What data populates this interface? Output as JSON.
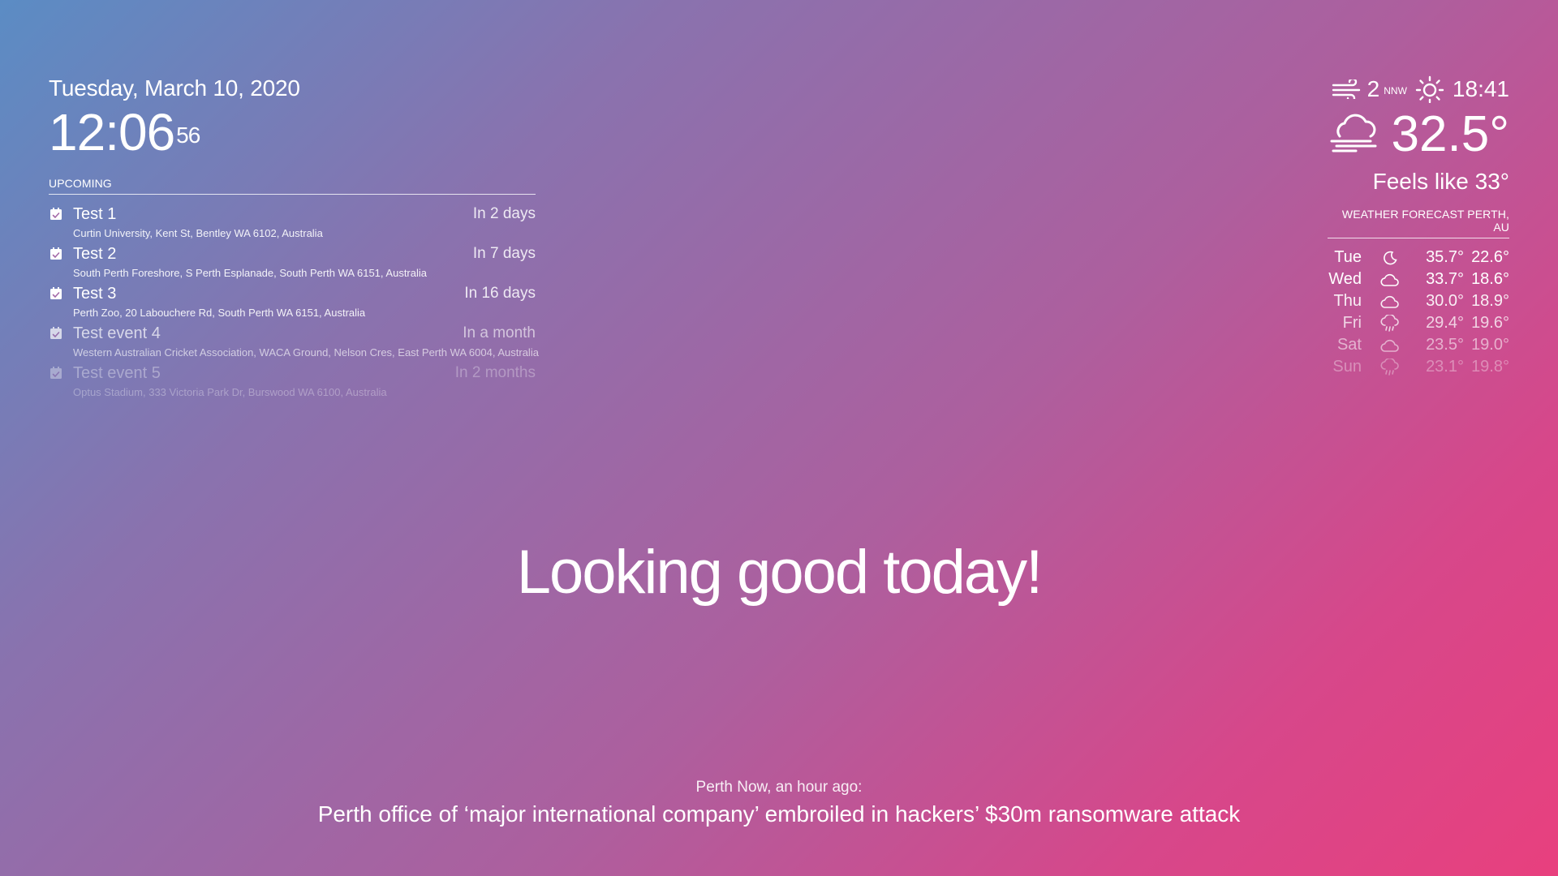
{
  "clock": {
    "date": "Tuesday, March 10, 2020",
    "time": "12:06",
    "seconds": "56"
  },
  "calendar": {
    "header": "UPCOMING",
    "events": [
      {
        "title": "Test 1",
        "when": "In 2 days",
        "location": "Curtin University, Kent St, Bentley WA 6102, Australia",
        "opacity": 1.0,
        "icon": "calendar-check-icon"
      },
      {
        "title": "Test 2",
        "when": "In 7 days",
        "location": "South Perth Foreshore, S Perth Esplanade, South Perth WA 6151, Australia",
        "opacity": 1.0,
        "icon": "calendar-check-icon"
      },
      {
        "title": "Test 3",
        "when": "In 16 days",
        "location": "Perth Zoo, 20 Labouchere Rd, South Perth WA 6151, Australia",
        "opacity": 1.0,
        "icon": "calendar-check-icon"
      },
      {
        "title": "Test event 4",
        "when": "In a month",
        "location": "Western Australian Cricket Association, WACA Ground, Nelson Cres, East Perth WA 6004, Australia",
        "opacity": 0.7,
        "icon": "calendar-check-icon"
      },
      {
        "title": "Test event 5",
        "when": "In 2 months",
        "location": "Optus Stadium, 333 Victoria Park Dr, Burswood WA 6100, Australia",
        "opacity": 0.35,
        "icon": "calendar-check-icon"
      }
    ]
  },
  "current_weather": {
    "wind_speed": "2",
    "wind_direction": "NNW",
    "sun_time": "18:41",
    "temperature": "32.5°",
    "feels_like": "Feels like 33°",
    "icons": {
      "wind": "wind-icon",
      "sun": "sunset-icon",
      "condition": "cloudy-windy-icon"
    }
  },
  "forecast": {
    "header": "WEATHER FORECAST PERTH, AU",
    "days": [
      {
        "day": "Tue",
        "icon": "moon-icon",
        "max": "35.7°",
        "min": "22.6°",
        "opacity": 1.0
      },
      {
        "day": "Wed",
        "icon": "cloud-icon",
        "max": "33.7°",
        "min": "18.6°",
        "opacity": 1.0
      },
      {
        "day": "Thu",
        "icon": "cloud-icon",
        "max": "30.0°",
        "min": "18.9°",
        "opacity": 0.9
      },
      {
        "day": "Fri",
        "icon": "rain-cloud-icon",
        "max": "29.4°",
        "min": "19.6°",
        "opacity": 0.75
      },
      {
        "day": "Sat",
        "icon": "cloud-icon",
        "max": "23.5°",
        "min": "19.0°",
        "opacity": 0.55
      },
      {
        "day": "Sun",
        "icon": "rain-cloud-icon",
        "max": "23.1°",
        "min": "19.8°",
        "opacity": 0.35
      }
    ]
  },
  "compliment": {
    "text": "Looking good today!"
  },
  "news": {
    "source": "Perth Now, an hour ago:",
    "headline": "Perth office of ‘major international company’ embroiled in hackers’ $30m ransomware attack"
  },
  "colors": {
    "text": "#ffffff",
    "gradient_start": "#5b8cc4",
    "gradient_end": "#e8407e"
  }
}
